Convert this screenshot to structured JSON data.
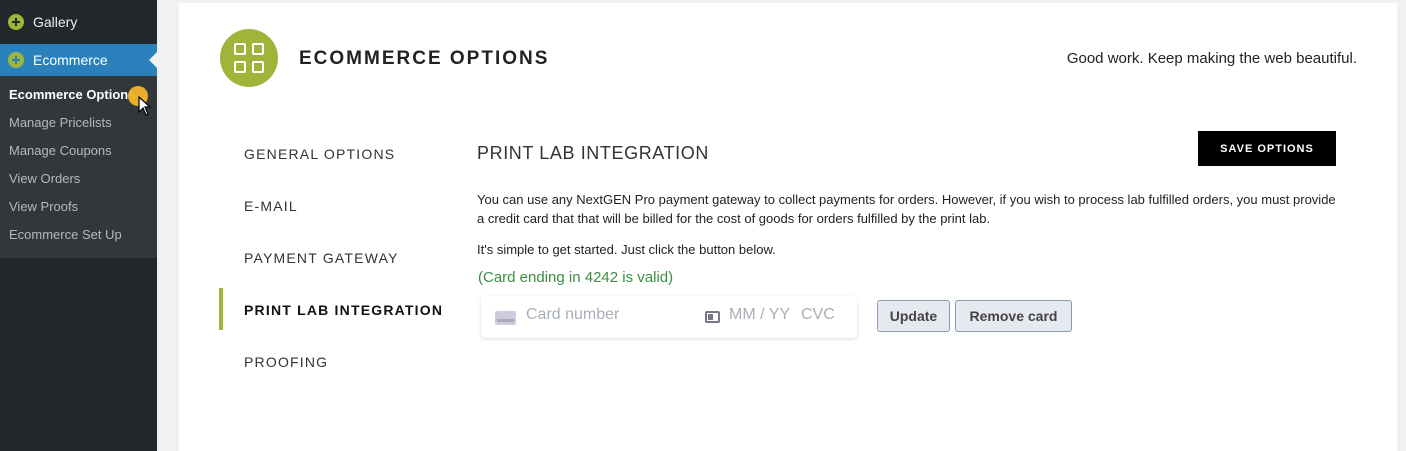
{
  "sidebar": {
    "gallery_label": "Gallery",
    "ecommerce_label": "Ecommerce",
    "submenu": [
      "Ecommerce Options",
      "Manage Pricelists",
      "Manage Coupons",
      "View Orders",
      "View Proofs",
      "Ecommerce Set Up"
    ]
  },
  "header": {
    "title": "ECOMMERCE OPTIONS",
    "tagline": "Good work. Keep making the web beautiful."
  },
  "tabs": [
    "GENERAL OPTIONS",
    "E-MAIL",
    "PAYMENT GATEWAY",
    "PRINT LAB INTEGRATION",
    "PROOFING"
  ],
  "active_tab": "PRINT LAB INTEGRATION",
  "section": {
    "title": "PRINT LAB INTEGRATION",
    "save_label": "SAVE OPTIONS",
    "description": "You can use any NextGEN Pro payment gateway to collect payments for orders. However, if you wish to process lab fulfilled orders, you must provide a credit card that that will be billed for the cost of goods for orders fulfilled by the print lab.",
    "instruction": "It's simple to get started. Just click the button below.",
    "status": "(Card ending in 4242 is valid)"
  },
  "card_form": {
    "number_placeholder": "Card number",
    "expiry_placeholder": "MM / YY",
    "cvc_placeholder": "CVC",
    "update_label": "Update",
    "remove_label": "Remove card"
  },
  "colors": {
    "accent": "#9fb53a",
    "sidebar_bg": "#23282d",
    "sidebar_active": "#2a80bb",
    "valid_text": "#3e8e41"
  }
}
